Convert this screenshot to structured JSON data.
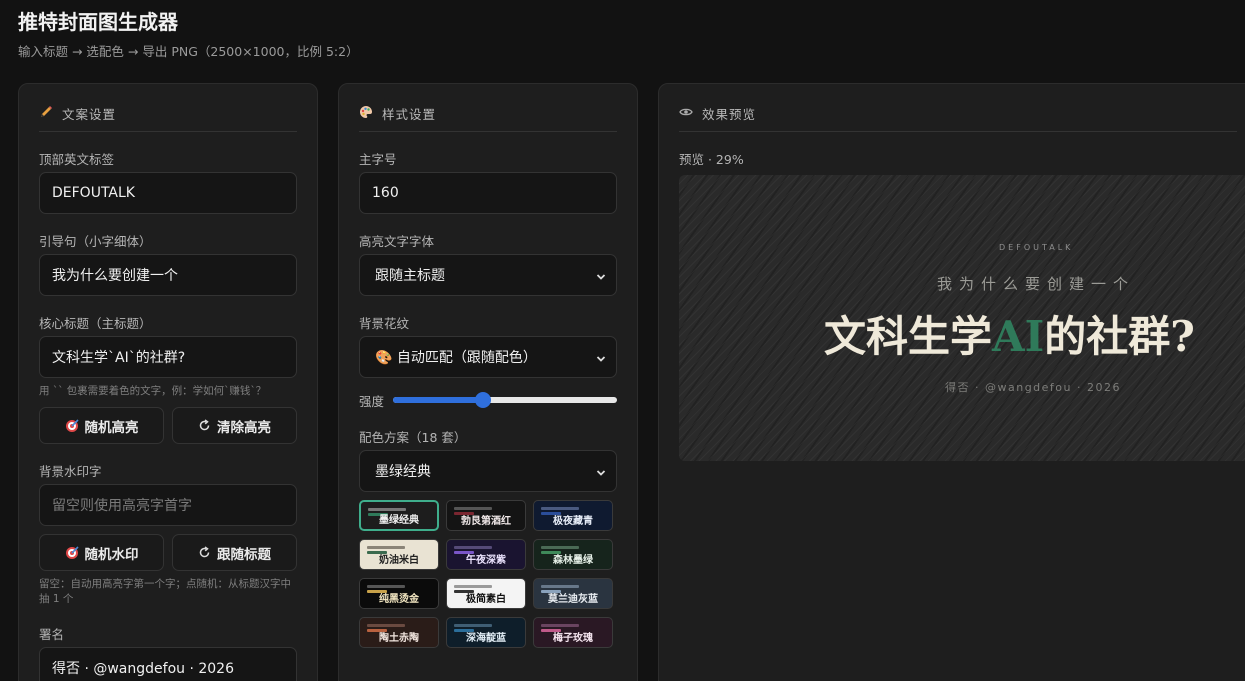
{
  "header": {
    "title": "推特封面图生成器",
    "subtitle": "输入标题 → 选配色 → 导出 PNG（2500×1000，比例 5:2）"
  },
  "copy_panel": {
    "title": "文案设置",
    "tag_label": "顶部英文标签",
    "tag_value": "DEFOUTALK",
    "lead_label": "引导句（小字细体）",
    "lead_value": "我为什么要创建一个",
    "title_label": "核心标题（主标题）",
    "title_value": "文科生学`AI`的社群?",
    "title_hint": "用 `` 包裹需要着色的文字，例：学如何`赚钱`？",
    "random_highlight": "随机高亮",
    "clear_highlight": "清除高亮",
    "watermark_label": "背景水印字",
    "watermark_placeholder": "留空则使用高亮字首字",
    "random_watermark": "随机水印",
    "follow_title": "跟随标题",
    "watermark_hint": "留空：自动用高亮字第一个字；点随机：从标题汉字中抽 1 个",
    "sign_label": "署名",
    "sign_value": "得否 · @wangdefou · 2026"
  },
  "style_panel": {
    "title": "样式设置",
    "font_size_label": "主字号",
    "font_size_value": "160",
    "hl_font_label": "高亮文字字体",
    "hl_font_value": "跟随主标题",
    "pattern_label": "背景花纹",
    "pattern_value": "🎨 自动匹配（跟随配色）",
    "strength_label": "强度",
    "strength": 0.4,
    "scheme_label": "配色方案（18 套）",
    "scheme_value": "墨绿经典",
    "swatches": [
      {
        "name": "墨绿经典",
        "bg": "#1d1d1d",
        "fg": "#f0f0f0",
        "a": "#777777",
        "b": "#2f7a5a",
        "selected": true
      },
      {
        "name": "勃艮第酒红",
        "bg": "#141414",
        "fg": "#f0e8e8",
        "a": "#555555",
        "b": "#7a2630",
        "selected": false
      },
      {
        "name": "极夜藏青",
        "bg": "#0f1a30",
        "fg": "#e8eef8",
        "a": "#4a5a80",
        "b": "#2b4e9a",
        "selected": false
      },
      {
        "name": "奶油米白",
        "bg": "#e9e3d3",
        "fg": "#222222",
        "a": "#8a8478",
        "b": "#3a6a4e",
        "selected": false
      },
      {
        "name": "午夜深紫",
        "bg": "#1a1430",
        "fg": "#ece4ff",
        "a": "#554a77",
        "b": "#7a56c8",
        "selected": false
      },
      {
        "name": "森林墨绿",
        "bg": "#16241c",
        "fg": "#e6f0e8",
        "a": "#4a6a55",
        "b": "#3f8a5a",
        "selected": false
      },
      {
        "name": "纯黑烫金",
        "bg": "#0b0b0b",
        "fg": "#f3e7c2",
        "a": "#555555",
        "b": "#c8a24a",
        "selected": false
      },
      {
        "name": "极简素白",
        "bg": "#f4f4f4",
        "fg": "#111111",
        "a": "#9a9a9a",
        "b": "#333333",
        "selected": false
      },
      {
        "name": "莫兰迪灰蓝",
        "bg": "#2a3440",
        "fg": "#e9edf2",
        "a": "#68788a",
        "b": "#8aa2bc",
        "selected": false
      },
      {
        "name": "陶土赤陶",
        "bg": "#2a1c18",
        "fg": "#f2e6df",
        "a": "#6a4a40",
        "b": "#b8613f",
        "selected": false
      },
      {
        "name": "深海靛蓝",
        "bg": "#0e1e2a",
        "fg": "#e2eef6",
        "a": "#3f5e74",
        "b": "#2b6e9a",
        "selected": false
      },
      {
        "name": "梅子玫瑰",
        "bg": "#2a1824",
        "fg": "#f6e6f0",
        "a": "#6a4460",
        "b": "#c05a8a",
        "selected": false
      }
    ]
  },
  "preview_panel": {
    "title": "效果预览",
    "label": "预览 · 29%",
    "tag": "DEFOUTALK",
    "lead": "我为什么要创建一个",
    "title_before": "文科生学",
    "title_highlight": "AI",
    "title_after": "的社群?",
    "sign": "得否 · @wangdefou · 2026"
  },
  "colors": {
    "accent_green": "#2f7a5a",
    "selected_border": "#3fae8c",
    "slider_blue": "#2f6fdc"
  }
}
